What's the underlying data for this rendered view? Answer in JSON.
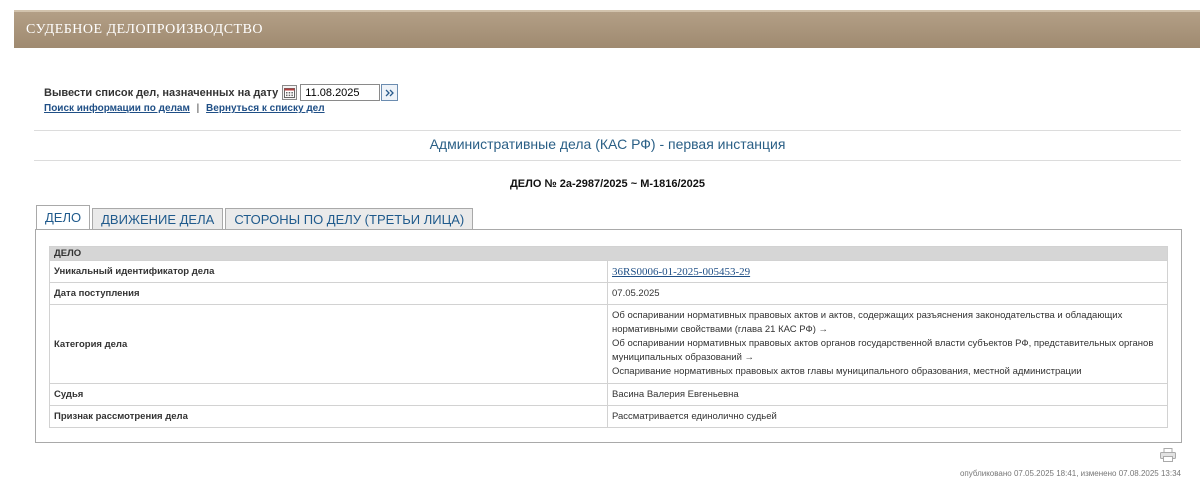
{
  "header": {
    "title": "СУДЕБНОЕ ДЕЛОПРОИЗВОДСТВО"
  },
  "date_filter": {
    "label": "Вывести список дел, назначенных на дату",
    "value": "11.08.2025"
  },
  "links": {
    "search": "Поиск информации по делам",
    "separator": "|",
    "back": "Вернуться к списку дел"
  },
  "section_title": "Административные дела (КАС РФ) - первая инстанция",
  "case_number": "ДЕЛО № 2а-2987/2025 ~ М-1816/2025",
  "tabs": [
    {
      "label": "Дело",
      "active": true
    },
    {
      "label": "Движение дела",
      "active": false
    },
    {
      "label": "Стороны по делу (третьи лица)",
      "active": false
    }
  ],
  "case_table": {
    "header": "ДЕЛО",
    "rows": [
      {
        "label": "Уникальный идентификатор дела",
        "value": "36RS0006-01-2025-005453-29"
      },
      {
        "label": "Дата поступления",
        "value": "07.05.2025"
      },
      {
        "label": "Категория дела",
        "lines": [
          "Об оспаривании нормативных правовых актов и актов, содержащих разъяснения законодательства и обладающих",
          "нормативными свойствами (глава 21 КАС РФ) →",
          "Об оспаривании нормативных правовых актов органов государственной власти субъектов РФ, представительных органов",
          "муниципальных образований →",
          "Оспаривание нормативных правовых актов главы муниципального образования, местной администрации"
        ]
      },
      {
        "label": "Судья",
        "value": "Васина Валерия Евгеньевна"
      },
      {
        "label": "Признак рассмотрения дела",
        "value": "Рассматривается единолично судьей"
      }
    ]
  },
  "footer": {
    "published": "опубликовано 07.05.2025 18:41, изменено 07.08.2025 13:34"
  },
  "icons": {
    "calendar": "calendar-icon",
    "go": "double-chevron-right-icon",
    "print": "printer-icon"
  }
}
